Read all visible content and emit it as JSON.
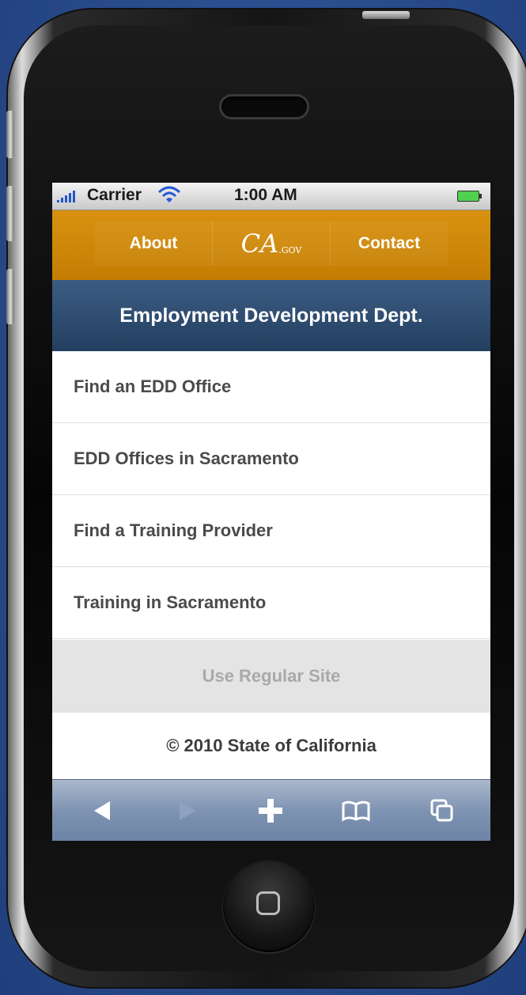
{
  "status_bar": {
    "carrier": "Carrier",
    "time": "1:00 AM",
    "signal_icon": "signal-bars-icon",
    "wifi_icon": "wifi-icon",
    "battery_icon": "battery-icon"
  },
  "nav": {
    "about": "About",
    "logo_text": "CA",
    "logo_sub": ".GOV",
    "contact": "Contact"
  },
  "header": {
    "title": "Employment Development Dept."
  },
  "menu": {
    "items": [
      {
        "label": "Find an EDD Office"
      },
      {
        "label": "EDD Offices in Sacramento"
      },
      {
        "label": "Find a Training Provider"
      },
      {
        "label": "Training in Sacramento"
      }
    ]
  },
  "regular_site": {
    "label": "Use Regular Site"
  },
  "footer": {
    "copyright": "© 2010 State of California"
  },
  "toolbar": {
    "icons": [
      "back-arrow-icon",
      "forward-arrow-icon",
      "add-plus-icon",
      "bookmarks-book-icon",
      "pages-icon"
    ]
  },
  "colors": {
    "nav_gold": "#c98505",
    "header_blue": "#2c4a6e",
    "toolbar_blue": "#7e93b2",
    "background_blue": "#2c4f8f"
  }
}
